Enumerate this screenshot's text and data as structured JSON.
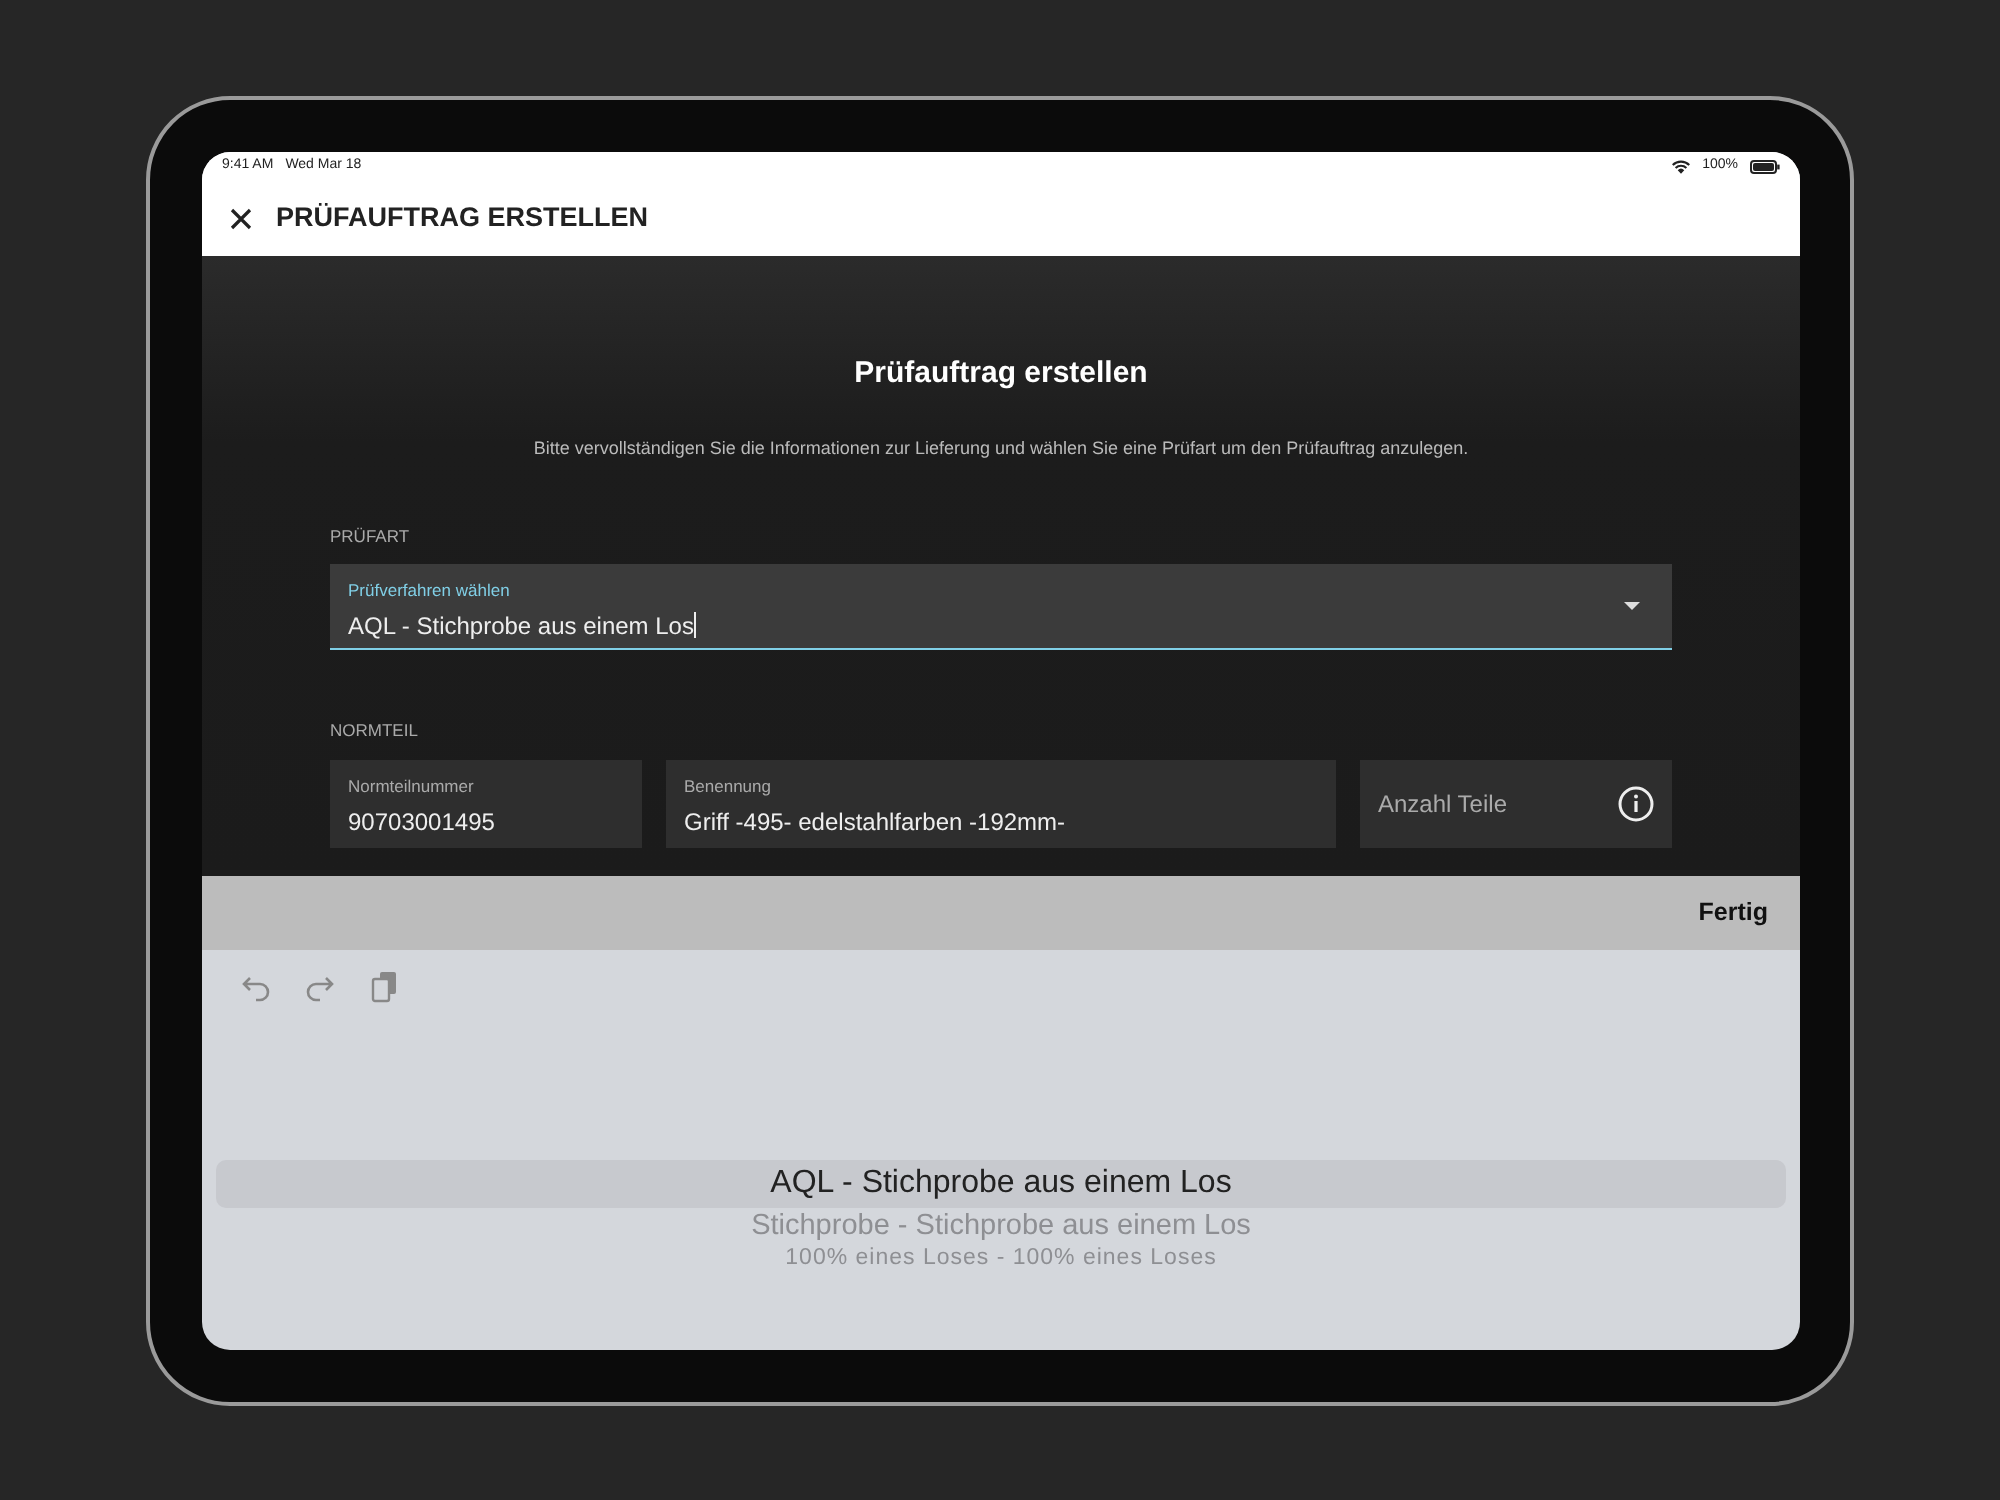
{
  "status_bar": {
    "time": "9:41 AM",
    "date": "Wed Mar 18",
    "battery": "100%"
  },
  "app_bar": {
    "title": "PRÜFAUFTRAG ERSTELLEN"
  },
  "form": {
    "heading": "Prüfauftrag erstellen",
    "description": "Bitte vervollständigen Sie die Informationen zur Lieferung und wählen Sie eine Prüfart um den Prüfauftrag anzulegen.",
    "sections": [
      {
        "label": "PRÜFART",
        "fields": [
          {
            "kind": "select",
            "label": "Prüfverfahren wählen",
            "value": "AQL - Stichprobe aus einem Los",
            "focused": true
          }
        ]
      },
      {
        "label": "NORMTEIL",
        "fields": [
          {
            "kind": "text",
            "label": "Normteilnummer",
            "value": "90703001495",
            "focused": false
          },
          {
            "kind": "text",
            "label": "Benennung",
            "value": "Griff -495- edelstahlfarben -192mm-",
            "focused": false
          },
          {
            "kind": "info",
            "placeholder": "Anzahl Teile",
            "focused": false
          }
        ]
      }
    ]
  },
  "keyboard_toolbar": {
    "done": "Fertig"
  },
  "picker": {
    "options": [
      {
        "label": "AQL - Stichprobe aus einem Los",
        "selected": true
      },
      {
        "label": "Stichprobe - Stichprobe aus einem Los",
        "selected": false
      },
      {
        "label": "100% eines Loses - 100% eines Loses",
        "selected": false
      }
    ]
  }
}
